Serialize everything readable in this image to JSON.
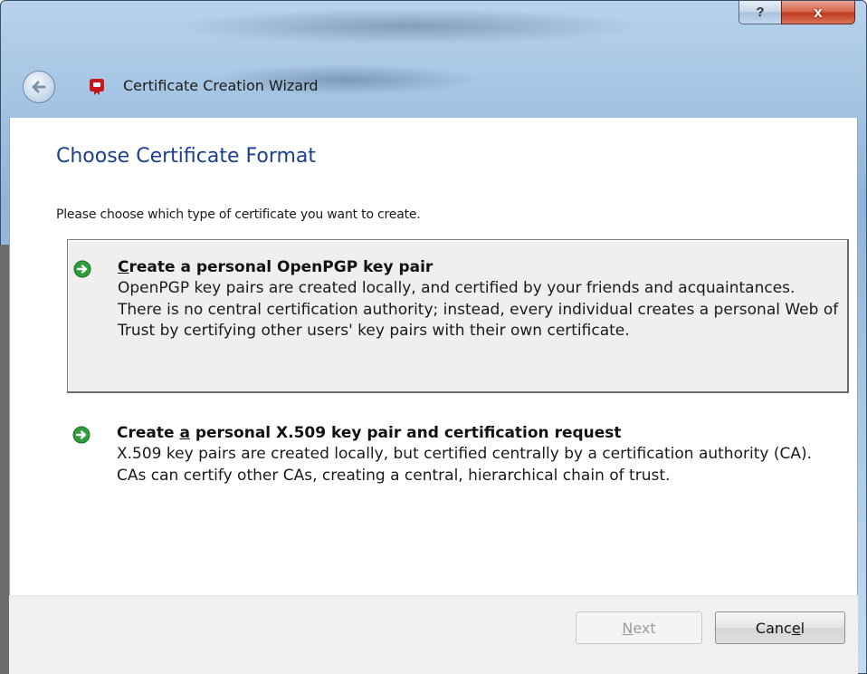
{
  "window": {
    "title": "Certificate Creation Wizard",
    "help_glyph": "?",
    "close_glyph": "x"
  },
  "page": {
    "title": "Choose Certificate Format",
    "instruction": "Please choose which type of certificate you want to create."
  },
  "options": [
    {
      "mnemonic": "C",
      "title_rest": "reate a personal OpenPGP key pair",
      "description": "OpenPGP key pairs are created locally, and certified by your friends and acquaintances. There is no central certification authority; instead, every individual creates a personal Web of Trust by certifying other users' key pairs with their own certificate.",
      "selected": true
    },
    {
      "title_pre": "Create ",
      "mnemonic": "a",
      "title_rest": " personal X.509 key pair and certification request",
      "description": "X.509 key pairs are created locally, but certified centrally by a certification authority (CA). CAs can certify other CAs, creating a central, hierarchical chain of trust.",
      "selected": false
    }
  ],
  "buttons": {
    "next_mnemonic": "N",
    "next_rest": "ext",
    "cancel_pre": "Canc",
    "cancel_mnemonic": "e",
    "cancel_rest": "l"
  },
  "icons": {
    "back": "back-arrow-icon",
    "app": "certificate-app-icon",
    "option": "green-arrow-circle-icon"
  },
  "colors": {
    "page_title": "#1b3f8f",
    "option_icon": "#2e9d3a",
    "close_button": "#c0391f"
  }
}
